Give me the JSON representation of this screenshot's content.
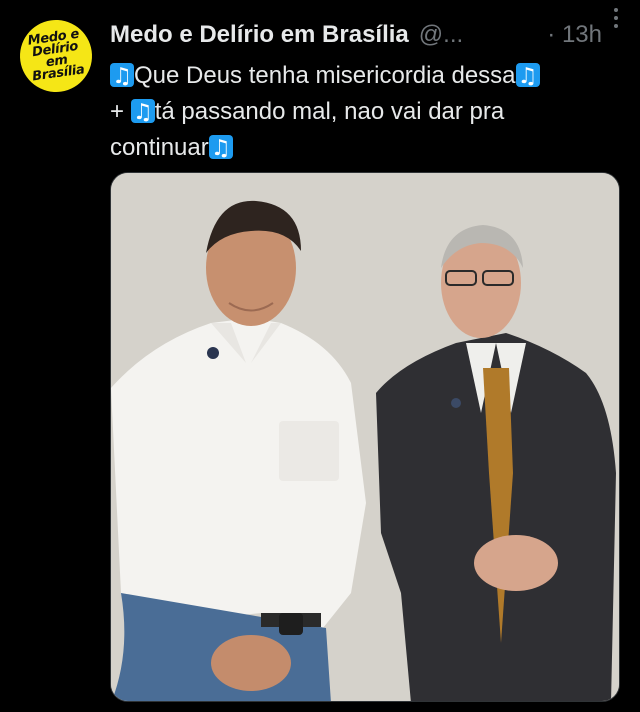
{
  "tweet": {
    "author_name": "Medo e Delírio em Brasília",
    "author_handle": "@...",
    "time": "· 13h",
    "avatar_text": "Medo e\nDelírio\nem Brasília",
    "text_line1": "Que Deus tenha misericordia dessa",
    "text_line2_prefix": "+",
    "text_line2": "tá passando mal, nao vai dar pra",
    "text_line3": "continuar"
  },
  "colors": {
    "background": "#000000",
    "text": "#e7e9ea",
    "secondary": "#71767b",
    "emoji_note": "#1d9bf0",
    "avatar": "#f5e616"
  },
  "icons": [
    "more-options-icon",
    "musical-note-icon"
  ]
}
